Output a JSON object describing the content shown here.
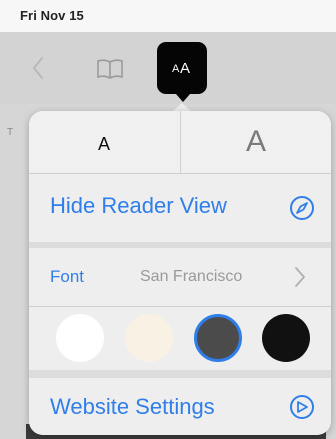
{
  "status_bar": {
    "time": "Fri Nov 15"
  },
  "toolbar": {
    "back_icon": "chevron-left-icon",
    "reader_icon": "book-icon",
    "aa_small": "A",
    "aa_large": "A"
  },
  "background_page": {
    "edge_letter": "T"
  },
  "popover": {
    "text_size": {
      "smaller": "A",
      "larger": "A"
    },
    "hide_reader_view": {
      "label": "Hide Reader View",
      "icon": "compass-icon"
    },
    "font": {
      "label": "Font",
      "value": "San Francisco",
      "icon": "chevron-right-icon"
    },
    "themes": [
      {
        "name": "white",
        "color": "#ffffff",
        "selected": false
      },
      {
        "name": "sepia",
        "color": "#f8f1e4",
        "selected": false
      },
      {
        "name": "gray",
        "color": "#4b4b4c",
        "selected": true
      },
      {
        "name": "black",
        "color": "#111111",
        "selected": false
      }
    ],
    "website_settings": {
      "label": "Website Settings",
      "icon": "settings-gauge-icon"
    }
  },
  "colors": {
    "accent": "#2f7ee9"
  }
}
